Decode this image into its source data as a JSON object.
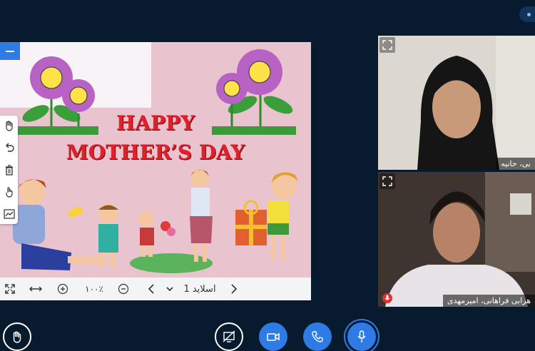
{
  "slide": {
    "title_line1": "HAPPY",
    "title_line2": "MOTHER’S DAY"
  },
  "toolbar": {
    "zoom_level": "۱۰۰٪",
    "slide_label": "اسلاید 1"
  },
  "participants": [
    {
      "name": "بی، حانیه",
      "has_mic_badge": false
    },
    {
      "name": "هرابی فراهانی، امیرمهدی",
      "has_mic_badge": true
    }
  ],
  "colors": {
    "page_bg": "#071a2e",
    "accent": "#2f7be5",
    "title_red": "#e0202a",
    "mic_badge": "#d93030"
  },
  "bottom_controls": [
    "raise-hand-icon",
    "screen-share-off-icon",
    "camera-icon",
    "phone-icon",
    "microphone-icon"
  ]
}
